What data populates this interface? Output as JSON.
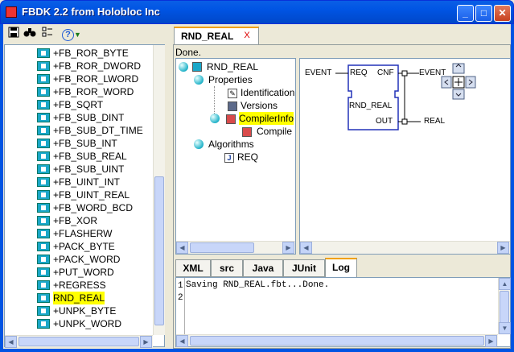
{
  "window": {
    "title": "FBDK 2.2 from Holobloc Inc"
  },
  "toolbar": {
    "help_label": "?"
  },
  "library_items": [
    {
      "label": "+FB_ROR_BYTE"
    },
    {
      "label": "+FB_ROR_DWORD"
    },
    {
      "label": "+FB_ROR_LWORD"
    },
    {
      "label": "+FB_ROR_WORD"
    },
    {
      "label": "+FB_SQRT"
    },
    {
      "label": "+FB_SUB_DINT"
    },
    {
      "label": "+FB_SUB_DT_TIME"
    },
    {
      "label": "+FB_SUB_INT"
    },
    {
      "label": "+FB_SUB_REAL"
    },
    {
      "label": "+FB_SUB_UINT"
    },
    {
      "label": "+FB_UINT_INT"
    },
    {
      "label": "+FB_UINT_REAL"
    },
    {
      "label": "+FB_WORD_BCD"
    },
    {
      "label": "+FB_XOR"
    },
    {
      "label": "+FLASHERW"
    },
    {
      "label": "+PACK_BYTE"
    },
    {
      "label": "+PACK_WORD"
    },
    {
      "label": "+PUT_WORD"
    },
    {
      "label": "+REGRESS"
    },
    {
      "label": "RND_REAL",
      "selected": true
    },
    {
      "label": "+UNPK_BYTE"
    },
    {
      "label": "+UNPK_WORD"
    }
  ],
  "editor_tab": {
    "label": "RND_REAL",
    "close": "X"
  },
  "status": "Done.",
  "tree": {
    "root": "RND_REAL",
    "properties": "Properties",
    "identification": "Identification",
    "versions": "Versions",
    "compiler_info": "CompilerInfo",
    "compile": "Compile",
    "algorithms": "Algorithms",
    "req": "REQ"
  },
  "diagram": {
    "fb_name": "RND_REAL",
    "event_in": "EVENT",
    "req": "REQ",
    "cnf": "CNF",
    "event_out": "EVENT",
    "out": "OUT",
    "real": "REAL"
  },
  "bottom_tabs": [
    {
      "label": "XML"
    },
    {
      "label": "src"
    },
    {
      "label": "Java"
    },
    {
      "label": "JUnit"
    },
    {
      "label": "Log",
      "active": true
    }
  ],
  "log": {
    "line_numbers": [
      "1",
      "2"
    ],
    "text": "Saving RND_REAL.fbt...Done."
  },
  "colors": {
    "titlebar": "#0054e3",
    "selection": "#ffff00",
    "fb_icon": "#1aa7c8",
    "tab_accent": "#f0a000"
  }
}
